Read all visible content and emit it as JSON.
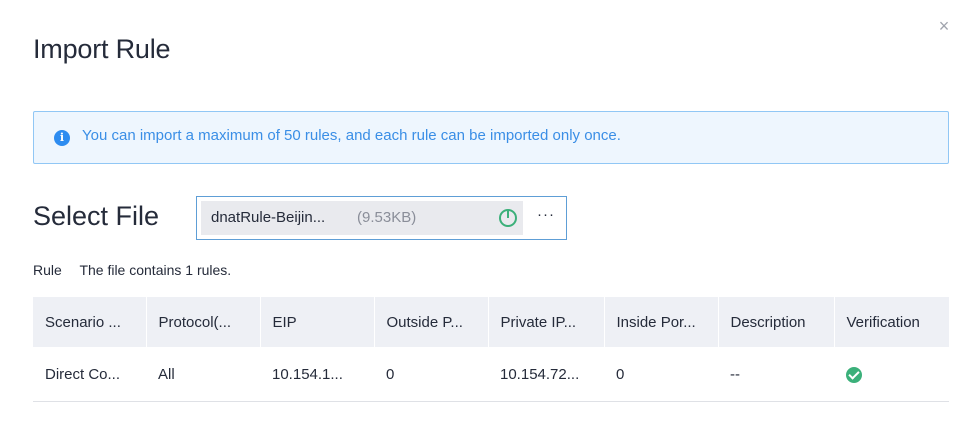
{
  "dialog": {
    "title": "Import Rule",
    "close_glyph": "×"
  },
  "alert": {
    "icon": "info-icon",
    "text": "You can import a maximum of 50 rules, and each rule can be imported only once.",
    "color": "#3a8ee6"
  },
  "file": {
    "section_label": "Select File",
    "name": "dnatRule-Beijin...",
    "size": "(9.53KB)",
    "status_icon": "progress-complete-icon",
    "more_label": "···"
  },
  "rules": {
    "label": "Rule",
    "summary": "The file contains 1 rules."
  },
  "table": {
    "headers": [
      "Scenario ...",
      "Protocol(...",
      "EIP",
      "Outside P...",
      "Private IP...",
      "Inside Por...",
      "Description",
      "Verification"
    ],
    "rows": [
      {
        "scenario": "Direct Co...",
        "protocol": "All",
        "eip": "10.154.1...",
        "outside_port": "0",
        "private_ip": "10.154.72...",
        "inside_port": "0",
        "description": "--",
        "verification_icon": "check-circle-icon"
      }
    ]
  },
  "colors": {
    "accent": "#2d8cf0",
    "success": "#3bb07a",
    "header_bg": "#eef0f5"
  }
}
